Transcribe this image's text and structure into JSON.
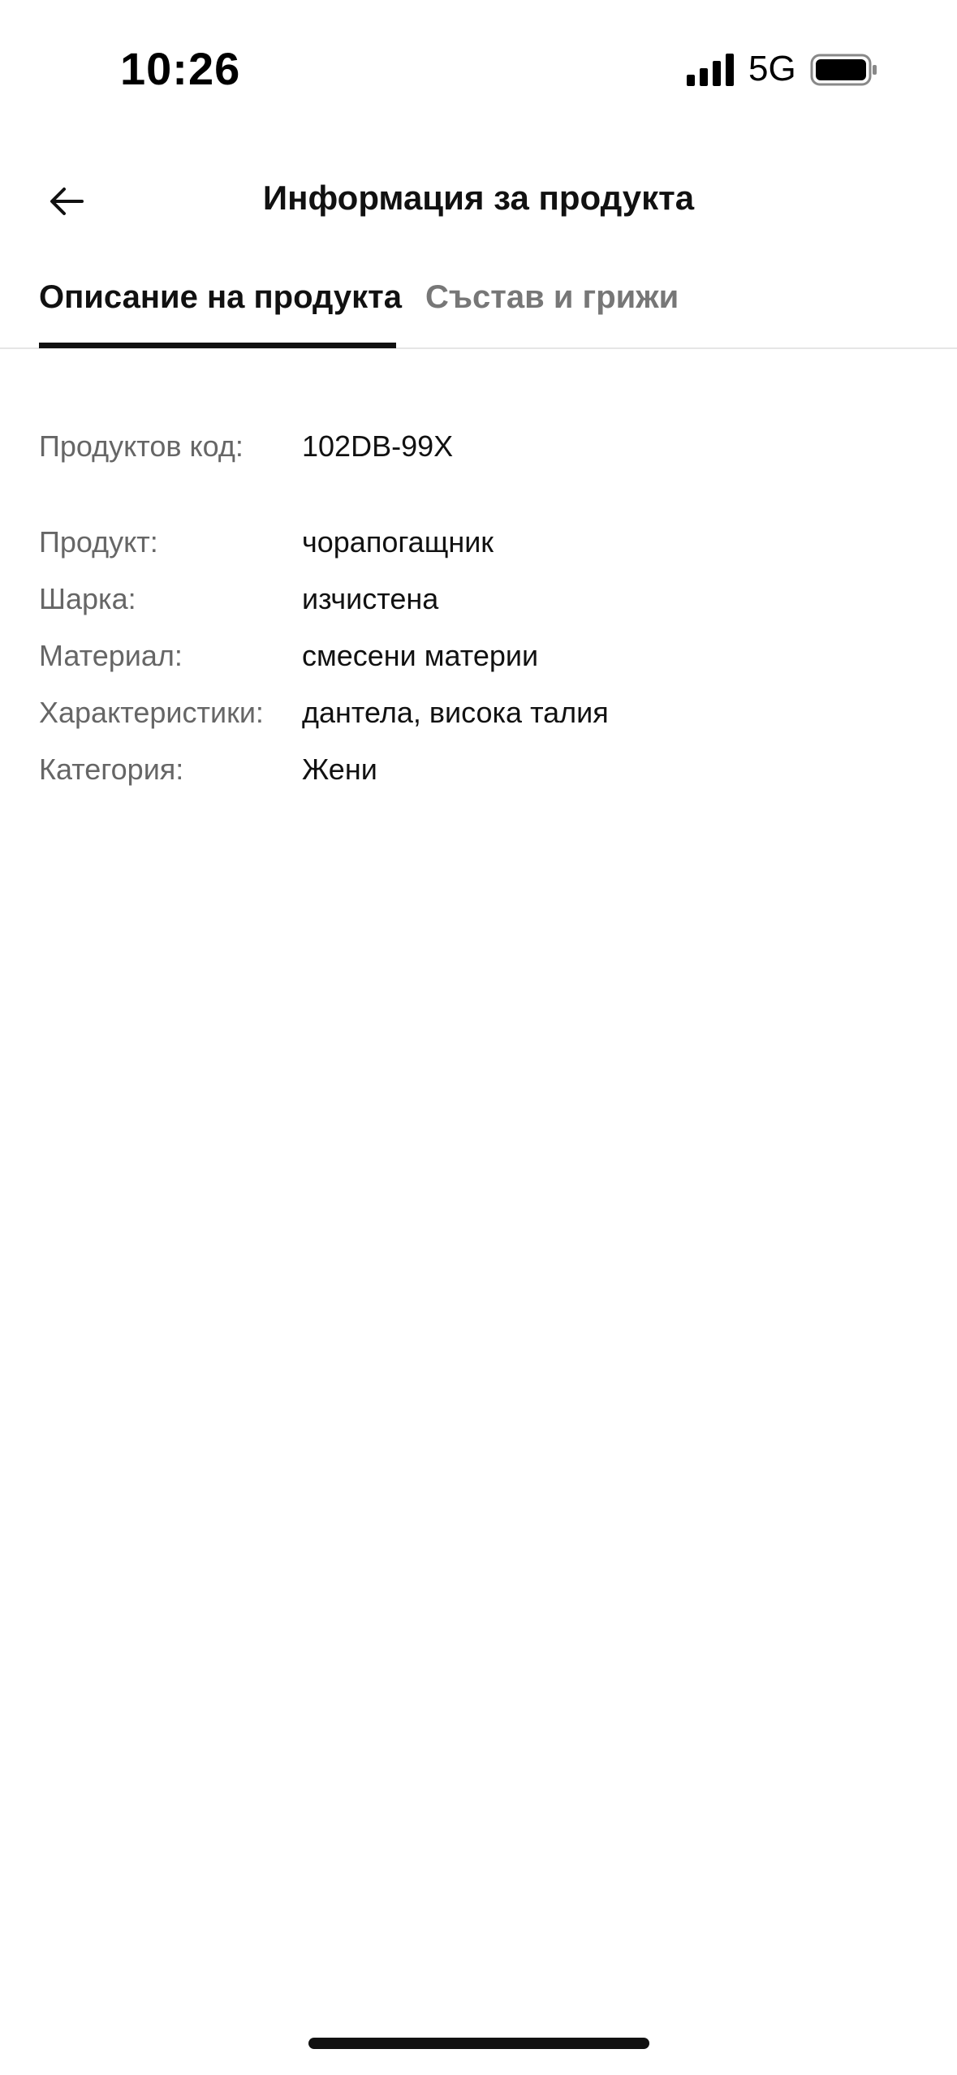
{
  "status_bar": {
    "time": "10:26",
    "network": "5G",
    "signal_icon": "cellular-signal-icon",
    "battery_icon": "battery-icon"
  },
  "header": {
    "back_icon": "arrow-left-icon",
    "title": "Информация за продукта"
  },
  "tabs": [
    {
      "label": "Описание на продукта",
      "active": true
    },
    {
      "label": "Състав и грижи",
      "active": false
    }
  ],
  "details": {
    "product_code": {
      "label": "Продуктов код:",
      "value": "102DB-99X"
    },
    "attributes": [
      {
        "label": "Продукт:",
        "value": "чорапогащник"
      },
      {
        "label": "Шарка:",
        "value": "изчистена"
      },
      {
        "label": "Материал:",
        "value": "смесени материи"
      },
      {
        "label": "Характеристики:",
        "value": "дантела, висока талия"
      },
      {
        "label": "Категория:",
        "value": "Жени"
      }
    ]
  },
  "colors": {
    "text": "#111111",
    "label": "#666666",
    "inactive_tab": "#777777",
    "divider": "#e6e6e6"
  }
}
